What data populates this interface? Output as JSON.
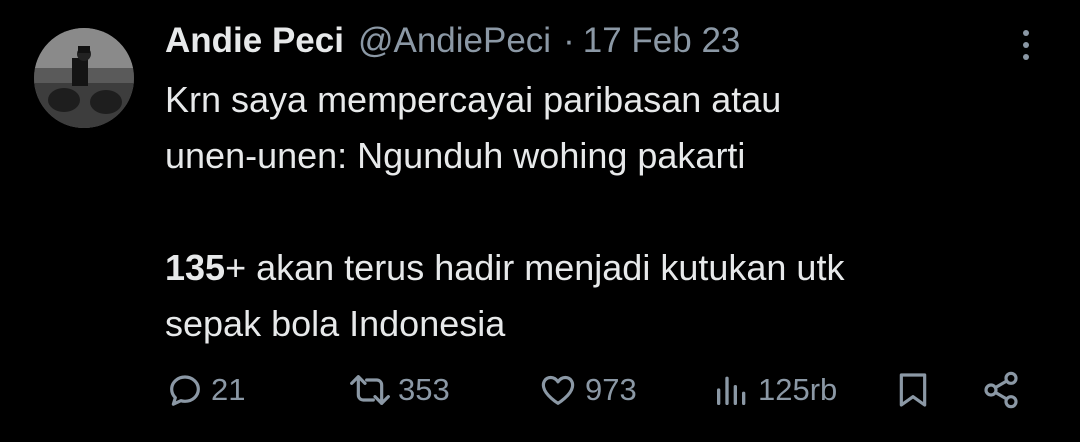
{
  "tweet": {
    "author": {
      "display_name": "Andie Peci",
      "handle": "@AndiePeci"
    },
    "separator": "·",
    "date": "17 Feb 23",
    "text": {
      "line1": "Krn saya mempercayai paribasan atau",
      "line2": "unen-unen: Ngunduh wohing pakarti",
      "para2_bold": "135",
      "para2_rest_line1": "+ akan terus hadir menjadi kutukan utk",
      "para2_line2": "sepak bola Indonesia"
    },
    "stats": {
      "replies": "21",
      "retweets": "353",
      "likes": "973",
      "views": "125rb"
    }
  },
  "colors": {
    "background": "#000000",
    "text": "#e7e9ea",
    "secondary": "#8b98a5"
  },
  "icons": {
    "reply": "reply-icon",
    "retweet": "retweet-icon",
    "like": "heart-icon",
    "views": "views-chart-icon",
    "bookmark": "bookmark-icon",
    "share": "share-icon",
    "more": "more-icon"
  }
}
